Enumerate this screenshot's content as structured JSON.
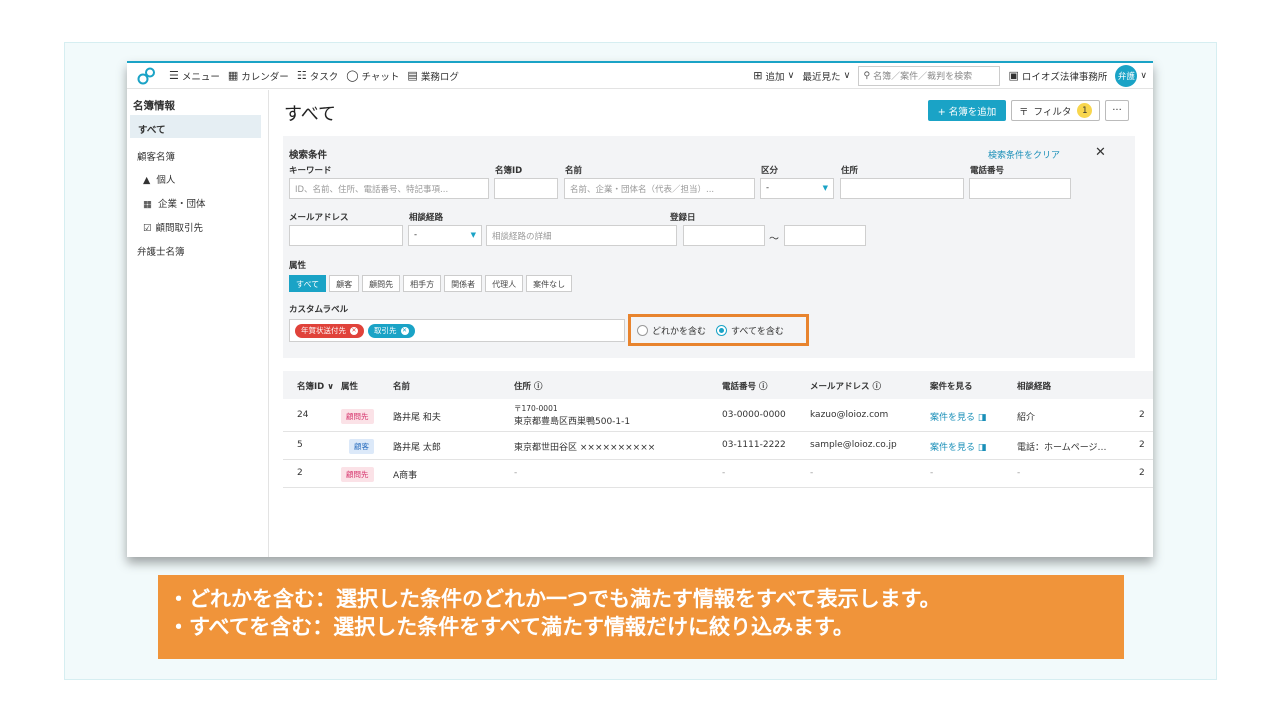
{
  "topbar": {
    "menu": "メニュー",
    "calendar": "カレンダー",
    "task": "タスク",
    "chat": "チャット",
    "worklog": "業務ログ",
    "add": "追加",
    "recent": "最近見た",
    "search_placeholder": "名簿／案件／裁判を検索",
    "firm": "ロイオズ法律事務所",
    "avatar": "弁護"
  },
  "sidebar": {
    "title": "名簿情報",
    "all": "すべて",
    "client_list": "顧客名簿",
    "individual": "個人",
    "company": "企業・団体",
    "advisory": "顧問取引先",
    "lawyer_list": "弁護士名簿"
  },
  "main": {
    "title": "すべて",
    "add_button": "+ 名簿を追加",
    "filter_button": "フィルタ",
    "filter_count": "1",
    "more": "···"
  },
  "search": {
    "heading": "検索条件",
    "clear": "検索条件をクリア",
    "keyword_label": "キーワード",
    "keyword_placeholder": "ID、名前、住所、電話番号、特記事項...",
    "id_label": "名簿ID",
    "name_label": "名前",
    "name_placeholder": "名前、企業・団体名（代表／担当）...",
    "category_label": "区分",
    "category_value": "-",
    "address_label": "住所",
    "phone_label": "電話番号",
    "email_label": "メールアドレス",
    "route_label": "相談経路",
    "route_value": "-",
    "route_detail_placeholder": "相談経路の詳細",
    "reg_label": "登録日",
    "tilde": "～",
    "attr_label": "属性",
    "attr_tabs": [
      "すべて",
      "顧客",
      "顧問先",
      "相手方",
      "関係者",
      "代理人",
      "案件なし"
    ],
    "custom_label": "カスタムラベル",
    "tags": [
      {
        "label": "年賀状送付先",
        "color": "#e0423a"
      },
      {
        "label": "取引先",
        "color": "#1aa3c6"
      }
    ],
    "radio_any": "どれかを含む",
    "radio_all": "すべてを含む"
  },
  "table": {
    "headers": [
      "名簿ID ∨",
      "属性",
      "名前",
      "住所",
      "電話番号",
      "メールアドレス",
      "案件を見る",
      "相談経路"
    ],
    "rows": [
      {
        "id": "24",
        "attr": "顧問先",
        "name": "路井尾 和夫",
        "zip": "〒170-0001",
        "address": "東京都豊島区西巣鴨500-1-1",
        "phone": "03-0000-0000",
        "email": "kazuo@loioz.com",
        "case": "案件を見る",
        "route": "紹介",
        "trail": "2"
      },
      {
        "id": "5",
        "attr": "顧客",
        "name": "路井尾 太郎",
        "zip": "",
        "address": "東京都世田谷区 ××××××××××",
        "phone": "03-1111-2222",
        "email": "sample@loioz.co.jp",
        "case": "案件を見る",
        "route": "電話：ホームページ…",
        "trail": "2"
      },
      {
        "id": "2",
        "attr": "顧問先",
        "name": "A商事",
        "zip": "",
        "address": "-",
        "phone": "-",
        "email": "-",
        "case": "-",
        "route": "-",
        "trail": "2"
      }
    ]
  },
  "caption": {
    "line1": "・どれかを含む：選択した条件のどれか一つでも満たす情報をすべて表示します。",
    "line2": "・すべてを含む：選択した条件をすべて満たす情報だけに絞り込みます。"
  }
}
